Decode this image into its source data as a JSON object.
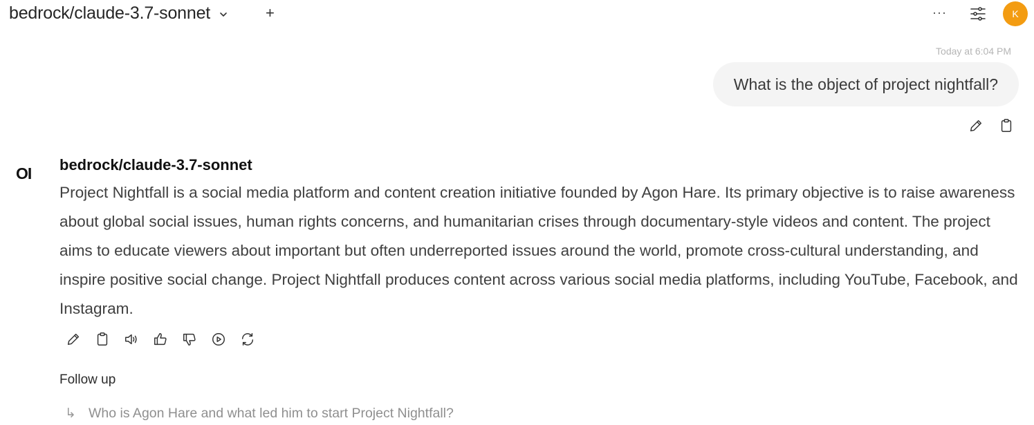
{
  "header": {
    "model_name": "bedrock/claude-3.7-sonnet",
    "new_chat_symbol": "+",
    "more_symbol": "···",
    "avatar_initial": "K",
    "avatar_color": "#f39c12",
    "icons": [
      "chevron-down-icon",
      "plus-icon",
      "more-icon",
      "sliders-icon"
    ]
  },
  "user_message": {
    "timestamp": "Today at 6:04 PM",
    "text": "What is the object of project nightfall?",
    "actions": [
      "edit-icon",
      "copy-icon"
    ]
  },
  "assistant_message": {
    "logo": "OI",
    "model_name": "bedrock/claude-3.7-sonnet",
    "text": "Project Nightfall is a social media platform and content creation initiative founded by Agon Hare. Its primary objective is to raise awareness about global social issues, human rights concerns, and humanitarian crises through documentary-style videos and content. The project aims to educate viewers about important but often underreported issues around the world, promote cross-cultural understanding, and inspire positive social change. Project Nightfall produces content across various social media platforms, including YouTube, Facebook, and Instagram.",
    "actions": [
      "edit-icon",
      "copy-icon",
      "read-aloud-icon",
      "thumbs-up-icon",
      "thumbs-down-icon",
      "play-icon",
      "regenerate-icon"
    ]
  },
  "follow_up": {
    "title": "Follow up",
    "arrow": "↳",
    "items": [
      "Who is Agon Hare and what led him to start Project Nightfall?"
    ]
  }
}
